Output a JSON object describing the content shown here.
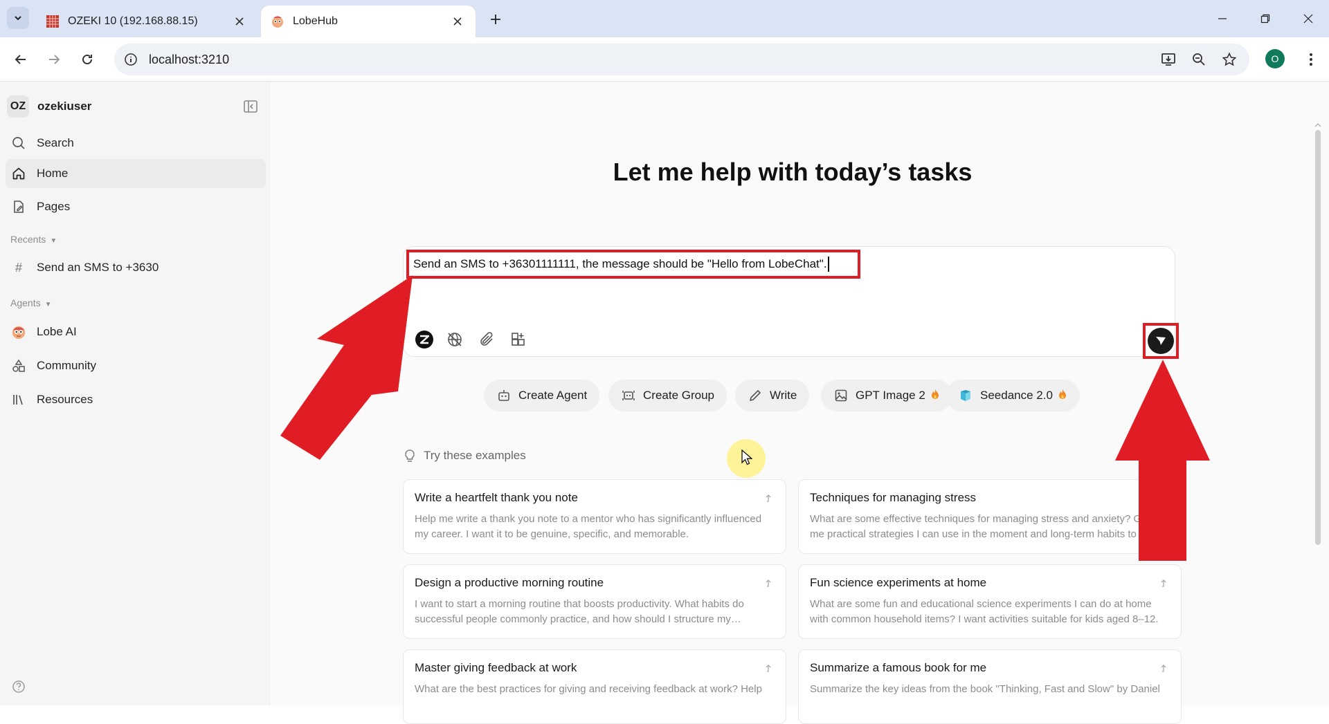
{
  "browser": {
    "tabs": [
      {
        "title": "OZEKI 10 (192.168.88.15)",
        "active": false
      },
      {
        "title": "LobeHub",
        "active": true
      }
    ],
    "url": "localhost:3210",
    "profile_initial": "O"
  },
  "sidebar": {
    "user_initials": "OZ",
    "user_name": "ozekiuser",
    "nav": {
      "search": "Search",
      "home": "Home",
      "pages": "Pages"
    },
    "recents_label": "Recents",
    "recents": [
      "Send an SMS to +3630"
    ],
    "agents_label": "Agents",
    "agents": [
      "Lobe AI"
    ],
    "community": "Community",
    "resources": "Resources"
  },
  "main": {
    "headline": "Let me help with today’s tasks",
    "composer_text": "Send an SMS to +36301111111, the message should be \"Hello from LobeChat\".",
    "chips": {
      "create_agent": "Create Agent",
      "create_group": "Create Group",
      "write": "Write",
      "gpt_image": "GPT Image 2",
      "seedance": "Seedance 2.0"
    },
    "examples_label": "Try these examples",
    "examples": [
      {
        "title": "Write a heartfelt thank you note",
        "desc": "Help me write a thank you note to a mentor who has significantly influenced my career. I want it to be genuine, specific, and memorable."
      },
      {
        "title": "Techniques for managing stress",
        "desc": "What are some effective techniques for managing stress and anxiety? Give me practical strategies I can use in the moment and long-term habits to build."
      },
      {
        "title": "Design a productive morning routine",
        "desc": "I want to start a morning routine that boosts productivity. What habits do successful people commonly practice, and how should I structure my…"
      },
      {
        "title": "Fun science experiments at home",
        "desc": "What are some fun and educational science experiments I can do at home with common household items? I want activities suitable for kids aged 8–12."
      },
      {
        "title": "Master giving feedback at work",
        "desc": "What are the best practices for giving and receiving feedback at work? Help"
      },
      {
        "title": "Summarize a famous book for me",
        "desc": "Summarize the key ideas from the book \"Thinking, Fast and Slow\" by Daniel"
      }
    ]
  },
  "colors": {
    "annotation_red": "#e01d24",
    "send_button": "#1a1a1a",
    "sidebar_bg": "#f5f5f5",
    "tabstrip_bg": "#dbe4f5"
  }
}
